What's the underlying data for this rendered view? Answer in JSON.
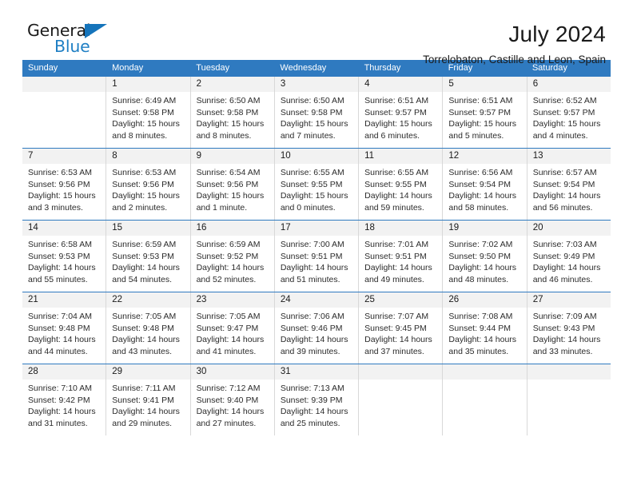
{
  "brand": {
    "name_part1": "General",
    "name_part2": "Blue"
  },
  "header": {
    "month_title": "July 2024",
    "location": "Torrelobaton, Castille and Leon, Spain"
  },
  "colors": {
    "header_blue": "#2f7ac0",
    "logo_blue": "#1f7fc4",
    "day_band_gray": "#f2f2f2",
    "cell_border": "#d8d8d8"
  },
  "calendar": {
    "weekdays": [
      "Sunday",
      "Monday",
      "Tuesday",
      "Wednesday",
      "Thursday",
      "Friday",
      "Saturday"
    ],
    "weeks": [
      [
        {
          "day": "",
          "lines": []
        },
        {
          "day": "1",
          "lines": [
            "Sunrise: 6:49 AM",
            "Sunset: 9:58 PM",
            "Daylight: 15 hours",
            "and 8 minutes."
          ]
        },
        {
          "day": "2",
          "lines": [
            "Sunrise: 6:50 AM",
            "Sunset: 9:58 PM",
            "Daylight: 15 hours",
            "and 8 minutes."
          ]
        },
        {
          "day": "3",
          "lines": [
            "Sunrise: 6:50 AM",
            "Sunset: 9:58 PM",
            "Daylight: 15 hours",
            "and 7 minutes."
          ]
        },
        {
          "day": "4",
          "lines": [
            "Sunrise: 6:51 AM",
            "Sunset: 9:57 PM",
            "Daylight: 15 hours",
            "and 6 minutes."
          ]
        },
        {
          "day": "5",
          "lines": [
            "Sunrise: 6:51 AM",
            "Sunset: 9:57 PM",
            "Daylight: 15 hours",
            "and 5 minutes."
          ]
        },
        {
          "day": "6",
          "lines": [
            "Sunrise: 6:52 AM",
            "Sunset: 9:57 PM",
            "Daylight: 15 hours",
            "and 4 minutes."
          ]
        }
      ],
      [
        {
          "day": "7",
          "lines": [
            "Sunrise: 6:53 AM",
            "Sunset: 9:56 PM",
            "Daylight: 15 hours",
            "and 3 minutes."
          ]
        },
        {
          "day": "8",
          "lines": [
            "Sunrise: 6:53 AM",
            "Sunset: 9:56 PM",
            "Daylight: 15 hours",
            "and 2 minutes."
          ]
        },
        {
          "day": "9",
          "lines": [
            "Sunrise: 6:54 AM",
            "Sunset: 9:56 PM",
            "Daylight: 15 hours",
            "and 1 minute."
          ]
        },
        {
          "day": "10",
          "lines": [
            "Sunrise: 6:55 AM",
            "Sunset: 9:55 PM",
            "Daylight: 15 hours",
            "and 0 minutes."
          ]
        },
        {
          "day": "11",
          "lines": [
            "Sunrise: 6:55 AM",
            "Sunset: 9:55 PM",
            "Daylight: 14 hours",
            "and 59 minutes."
          ]
        },
        {
          "day": "12",
          "lines": [
            "Sunrise: 6:56 AM",
            "Sunset: 9:54 PM",
            "Daylight: 14 hours",
            "and 58 minutes."
          ]
        },
        {
          "day": "13",
          "lines": [
            "Sunrise: 6:57 AM",
            "Sunset: 9:54 PM",
            "Daylight: 14 hours",
            "and 56 minutes."
          ]
        }
      ],
      [
        {
          "day": "14",
          "lines": [
            "Sunrise: 6:58 AM",
            "Sunset: 9:53 PM",
            "Daylight: 14 hours",
            "and 55 minutes."
          ]
        },
        {
          "day": "15",
          "lines": [
            "Sunrise: 6:59 AM",
            "Sunset: 9:53 PM",
            "Daylight: 14 hours",
            "and 54 minutes."
          ]
        },
        {
          "day": "16",
          "lines": [
            "Sunrise: 6:59 AM",
            "Sunset: 9:52 PM",
            "Daylight: 14 hours",
            "and 52 minutes."
          ]
        },
        {
          "day": "17",
          "lines": [
            "Sunrise: 7:00 AM",
            "Sunset: 9:51 PM",
            "Daylight: 14 hours",
            "and 51 minutes."
          ]
        },
        {
          "day": "18",
          "lines": [
            "Sunrise: 7:01 AM",
            "Sunset: 9:51 PM",
            "Daylight: 14 hours",
            "and 49 minutes."
          ]
        },
        {
          "day": "19",
          "lines": [
            "Sunrise: 7:02 AM",
            "Sunset: 9:50 PM",
            "Daylight: 14 hours",
            "and 48 minutes."
          ]
        },
        {
          "day": "20",
          "lines": [
            "Sunrise: 7:03 AM",
            "Sunset: 9:49 PM",
            "Daylight: 14 hours",
            "and 46 minutes."
          ]
        }
      ],
      [
        {
          "day": "21",
          "lines": [
            "Sunrise: 7:04 AM",
            "Sunset: 9:48 PM",
            "Daylight: 14 hours",
            "and 44 minutes."
          ]
        },
        {
          "day": "22",
          "lines": [
            "Sunrise: 7:05 AM",
            "Sunset: 9:48 PM",
            "Daylight: 14 hours",
            "and 43 minutes."
          ]
        },
        {
          "day": "23",
          "lines": [
            "Sunrise: 7:05 AM",
            "Sunset: 9:47 PM",
            "Daylight: 14 hours",
            "and 41 minutes."
          ]
        },
        {
          "day": "24",
          "lines": [
            "Sunrise: 7:06 AM",
            "Sunset: 9:46 PM",
            "Daylight: 14 hours",
            "and 39 minutes."
          ]
        },
        {
          "day": "25",
          "lines": [
            "Sunrise: 7:07 AM",
            "Sunset: 9:45 PM",
            "Daylight: 14 hours",
            "and 37 minutes."
          ]
        },
        {
          "day": "26",
          "lines": [
            "Sunrise: 7:08 AM",
            "Sunset: 9:44 PM",
            "Daylight: 14 hours",
            "and 35 minutes."
          ]
        },
        {
          "day": "27",
          "lines": [
            "Sunrise: 7:09 AM",
            "Sunset: 9:43 PM",
            "Daylight: 14 hours",
            "and 33 minutes."
          ]
        }
      ],
      [
        {
          "day": "28",
          "lines": [
            "Sunrise: 7:10 AM",
            "Sunset: 9:42 PM",
            "Daylight: 14 hours",
            "and 31 minutes."
          ]
        },
        {
          "day": "29",
          "lines": [
            "Sunrise: 7:11 AM",
            "Sunset: 9:41 PM",
            "Daylight: 14 hours",
            "and 29 minutes."
          ]
        },
        {
          "day": "30",
          "lines": [
            "Sunrise: 7:12 AM",
            "Sunset: 9:40 PM",
            "Daylight: 14 hours",
            "and 27 minutes."
          ]
        },
        {
          "day": "31",
          "lines": [
            "Sunrise: 7:13 AM",
            "Sunset: 9:39 PM",
            "Daylight: 14 hours",
            "and 25 minutes."
          ]
        },
        {
          "day": "",
          "lines": []
        },
        {
          "day": "",
          "lines": []
        },
        {
          "day": "",
          "lines": []
        }
      ]
    ]
  }
}
